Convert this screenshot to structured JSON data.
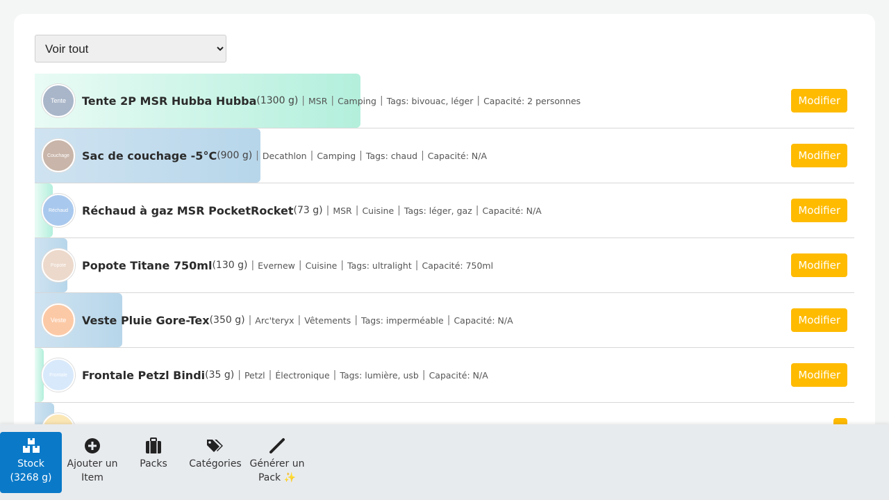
{
  "filter": {
    "selected": "Voir tout"
  },
  "items": [
    {
      "avatar": "Tente",
      "name": "Tente 2P MSR Hubba Hubba",
      "weight": "(1300 g)",
      "brand": "MSR",
      "category": "Camping",
      "tags": "Tags: bivouac, léger",
      "capacity": "Capacité: 2 personnes",
      "edit": "Modifier"
    },
    {
      "avatar": "Couchage",
      "name": "Sac de couchage -5°C",
      "weight": "(900 g)",
      "brand": "Decathlon",
      "category": "Camping",
      "tags": "Tags: chaud",
      "capacity": "Capacité: N/A",
      "edit": "Modifier"
    },
    {
      "avatar": "Réchaud",
      "name": "Réchaud à gaz MSR PocketRocket",
      "weight": "(73 g)",
      "brand": "MSR",
      "category": "Cuisine",
      "tags": "Tags: léger, gaz",
      "capacity": "Capacité: N/A",
      "edit": "Modifier"
    },
    {
      "avatar": "Popote",
      "name": "Popote Titane 750ml",
      "weight": "(130 g)",
      "brand": "Evernew",
      "category": "Cuisine",
      "tags": "Tags: ultralight",
      "capacity": "Capacité: 750ml",
      "edit": "Modifier"
    },
    {
      "avatar": "Veste",
      "name": "Veste Pluie Gore-Tex",
      "weight": "(350 g)",
      "brand": "Arc'teryx",
      "category": "Vêtements",
      "tags": "Tags: imperméable",
      "capacity": "Capacité: N/A",
      "edit": "Modifier"
    },
    {
      "avatar": "Frontale",
      "name": "Frontale Petzl Bindi",
      "weight": "(35 g)",
      "brand": "Petzl",
      "category": "Électronique",
      "tags": "Tags: lumière, usb",
      "capacity": "Capacité: N/A",
      "edit": "Modifier"
    }
  ],
  "nav": {
    "stock": {
      "label": "Stock",
      "total": "(3268 g)",
      "icon": "boxes-icon"
    },
    "add_item": {
      "label": "Ajouter un\nItem",
      "icon": "plus-circle-icon"
    },
    "packs": {
      "label": "Packs",
      "icon": "suitcase-icon"
    },
    "categories": {
      "label": "Catégories",
      "icon": "tags-icon"
    },
    "generate": {
      "label": "Générer un\nPack ✨",
      "icon": "wand-icon"
    }
  },
  "colors": {
    "accent_button": "#ffbb00",
    "nav_active": "#0a79c8",
    "bar_green": "#b3efdc",
    "bar_blue": "#b7d6ea"
  }
}
